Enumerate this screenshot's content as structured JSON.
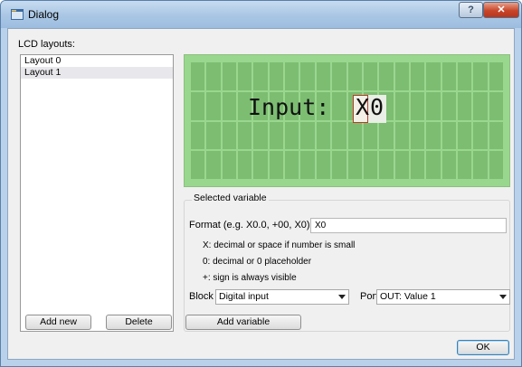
{
  "window": {
    "title": "Dialog",
    "help_glyph": "?",
    "close_glyph": "✕"
  },
  "layouts": {
    "label": "LCD layouts:",
    "items": [
      "Layout 0",
      "Layout 1"
    ],
    "selected_index": 1
  },
  "lcd": {
    "rows": 4,
    "cols": 20,
    "text_line": "Input: ",
    "cursor_char": "X",
    "after_cursor": "0",
    "background_color": "#9ad78e",
    "cell_color": "#7cbd72"
  },
  "selected_variable": {
    "group_title": "Selected variable",
    "format_label": "Format (e.g. X0.0, +00, X0)",
    "format_value": "X0",
    "hints": [
      "X: decimal or space if number is small",
      "0: decimal or 0 placeholder",
      "+: sign is always visible"
    ],
    "block_label": "Block",
    "block_value": "Digital input",
    "port_label": "Port",
    "port_value": "OUT: Value 1"
  },
  "buttons": {
    "add_new": "Add new",
    "delete": "Delete",
    "add_variable": "Add variable",
    "ok": "OK"
  },
  "icons": {
    "window": "app-window-icon",
    "dropdown": "chevron-down-icon"
  }
}
